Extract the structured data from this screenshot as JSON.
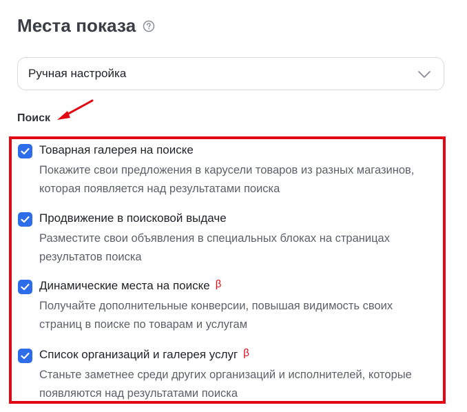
{
  "header": {
    "title": "Места показа",
    "help_icon": "question-circle-icon"
  },
  "placement_select": {
    "value": "Ручная настройка",
    "icon": "chevron-down-icon"
  },
  "search_section": {
    "label": "Поиск",
    "options": [
      {
        "title": "Товарная галерея на поиске",
        "description": "Покажите свои предложения в карусели товаров из разных магазинов, которая появляется над результатами поиска",
        "checked": true,
        "beta": ""
      },
      {
        "title": "Продвижение в поисковой выдаче",
        "description": "Разместите свои объявления в специальных блоках на страницах результатов поиска",
        "checked": true,
        "beta": ""
      },
      {
        "title": "Динамические места на поиске",
        "description": "Получайте дополнительные конверсии, повышая видимость своих страниц в поиске по товарам и услугам",
        "checked": true,
        "beta": "β"
      },
      {
        "title": "Список организаций и галерея услуг",
        "description": "Станьте заметнее среди других организаций и исполнителей, которые появляются над результатами поиска",
        "checked": true,
        "beta": "β"
      }
    ]
  },
  "colors": {
    "accent": "#2e6de9",
    "highlight": "#e30613",
    "border": "#d8dbe0",
    "secondary_text": "#5c6068"
  }
}
